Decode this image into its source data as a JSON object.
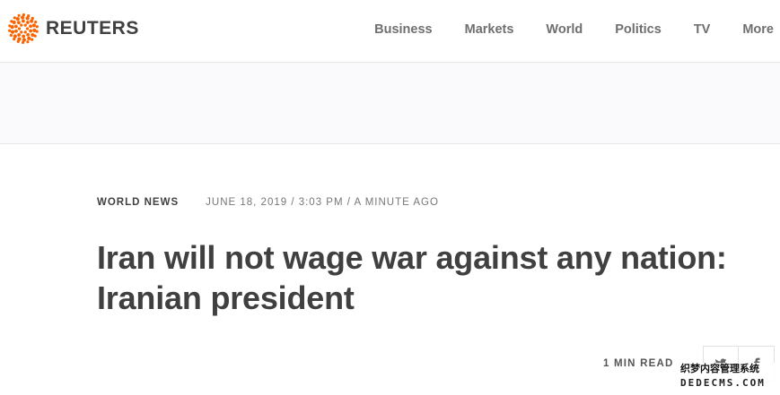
{
  "header": {
    "logo_text": "REUTERS",
    "nav": [
      "Business",
      "Markets",
      "World",
      "Politics",
      "TV",
      "More"
    ]
  },
  "article": {
    "section": "WORLD NEWS",
    "dateline": "JUNE 18, 2019 / 3:03 PM / A MINUTE AGO",
    "headline": "Iran will not wage war against any nation: Iranian president",
    "read_time": "1 MIN READ"
  },
  "share": {
    "icons": [
      "twitter-icon",
      "facebook-icon"
    ]
  },
  "watermark": {
    "line1": "织梦内容管理系统",
    "line2": "DEDECMS.COM"
  },
  "colors": {
    "brand_orange": "#fa6400",
    "text_dark": "#404040",
    "nav_gray": "#6f6f6f",
    "ad_band": "#faf9fb"
  }
}
